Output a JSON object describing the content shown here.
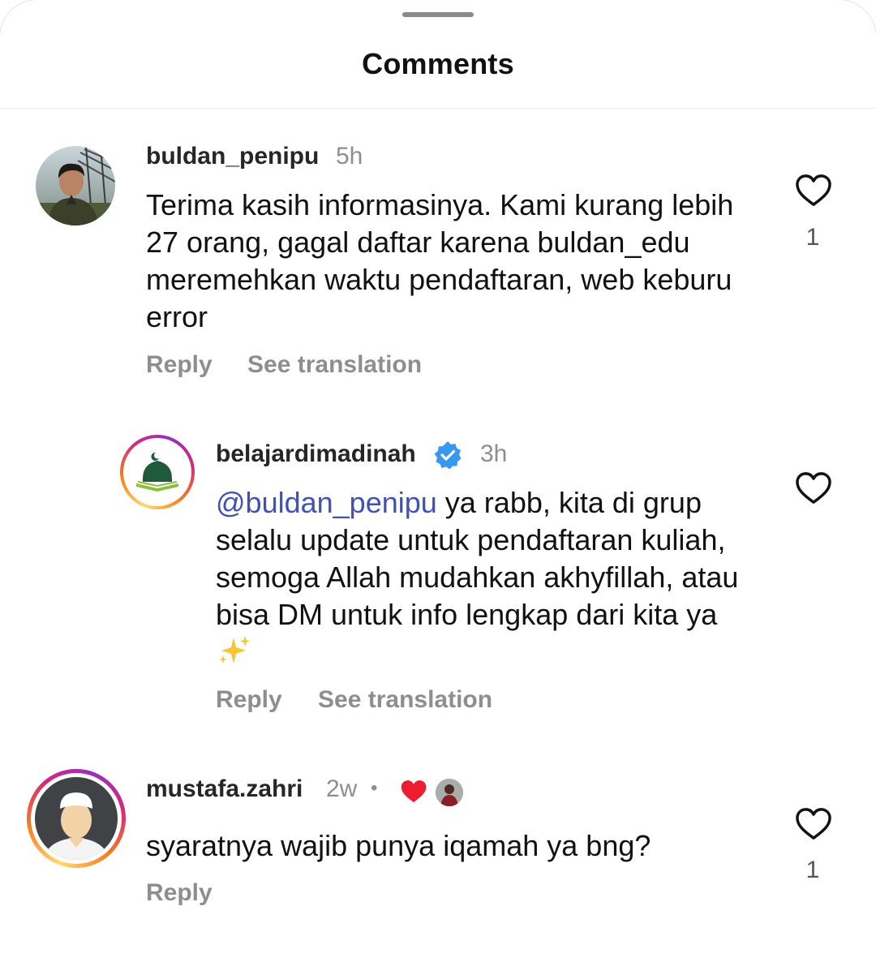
{
  "header": {
    "title": "Comments"
  },
  "comments": [
    {
      "username": "buldan_penipu",
      "time": "5h",
      "text": "Terima kasih informasinya. Kami kurang lebih 27 orang, gagal daftar karena buldan_edu meremehkan waktu pendaftaran, web keburu error",
      "reply_label": "Reply",
      "translate_label": "See translation",
      "likes": "1",
      "avatar_icon": "user-photo-avatar"
    },
    {
      "username": "belajardimadinah",
      "verified_icon": "verified-badge-icon",
      "time": "3h",
      "mention": "@buldan_penipu",
      "text": " ya rabb, kita di grup selalu update untuk pendaftaran kuliah, semoga Allah mudahkan akhyfillah, atau bisa DM untuk info lengkap dari kita ya ",
      "emoji": "sparkles",
      "reply_label": "Reply",
      "translate_label": "See translation",
      "likes": "",
      "avatar_icon": "mosque-logo-avatar"
    },
    {
      "username": "mustafa.zahri",
      "time": "2w",
      "separator": "•",
      "creator_liked_icon": "heart-filled-icon",
      "text": "syaratnya wajib punya iqamah ya bng?",
      "reply_label": "Reply",
      "likes": "1",
      "avatar_icon": "man-with-cap-avatar"
    }
  ],
  "colors": {
    "mention": "#3f51b5",
    "verified": "#3897f0",
    "heart": "#ed1c2e",
    "muted": "#8e8e8e"
  }
}
